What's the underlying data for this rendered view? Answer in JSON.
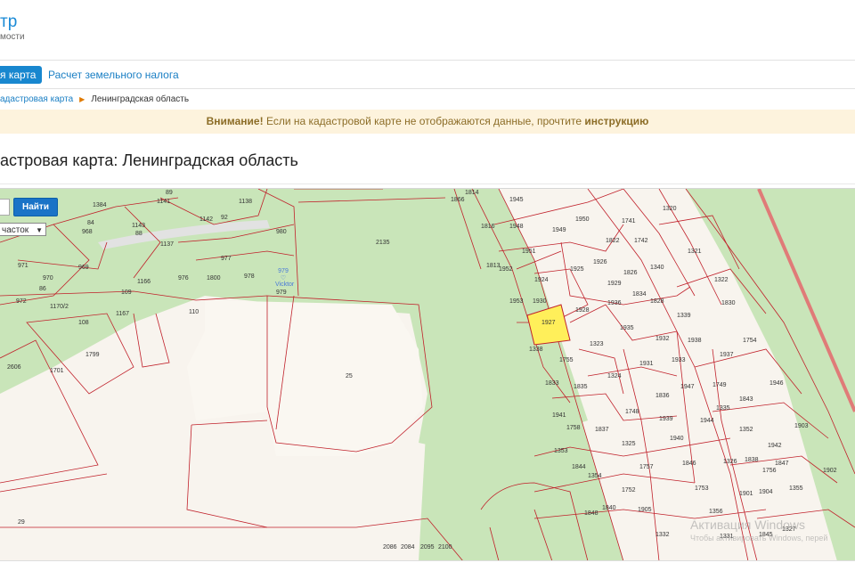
{
  "header": {
    "logo_title": "тр",
    "logo_subtitle": "мости"
  },
  "nav": {
    "tabs": [
      {
        "label": "я карта"
      },
      {
        "label": "Расчет земельного налога"
      }
    ]
  },
  "breadcrumbs": [
    "адастровая карта",
    "Ленинградская область"
  ],
  "notice": {
    "prefix": "Внимание!",
    "text": " Если на кадастровой карте не отображаются данные, прочтите ",
    "link": "инструкцию"
  },
  "page": {
    "title": "астровая карта: Ленинградская область"
  },
  "map_controls": {
    "search_value": "",
    "find_button": "Найти",
    "type_select": "часток",
    "marker_name": "Vicktor",
    "marker_number": "979"
  },
  "plots": [
    "89",
    "1141",
    "1384",
    "1138",
    "968",
    "84",
    "88",
    "1143",
    "1142",
    "92",
    "1137",
    "980",
    "971",
    "969",
    "977",
    "970",
    "86",
    "976",
    "978",
    "1166",
    "1800",
    "979",
    "972",
    "1170/2",
    "109",
    "1167",
    "110",
    "108",
    "1799",
    "1701",
    "2606",
    "25",
    "2135",
    "29",
    "2086",
    "2084",
    "2095",
    "2100",
    "1866",
    "1945",
    "1814",
    "1816",
    "1948",
    "1949",
    "1950",
    "1741",
    "1320",
    "1822",
    "1951",
    "1742",
    "1813",
    "1952",
    "1925",
    "1926",
    "1826",
    "1340",
    "1321",
    "1924",
    "1929",
    "1322",
    "1953",
    "1928",
    "1834",
    "1828",
    "1927",
    "1339",
    "1936",
    "1930",
    "1935",
    "1830",
    "1338",
    "1323",
    "1932",
    "1938",
    "1754",
    "1755",
    "1931",
    "1933",
    "1937",
    "1833",
    "1835",
    "1324",
    "1947",
    "1749",
    "1946",
    "1836",
    "1843",
    "1748",
    "1939",
    "1944",
    "1335",
    "1941",
    "1837",
    "1352",
    "1758",
    "1325",
    "1940",
    "1942",
    "1903",
    "1353",
    "1844",
    "1757",
    "1846",
    "1326",
    "1838",
    "1756",
    "1902",
    "1354",
    "1847",
    "1752",
    "1753",
    "1901",
    "1904",
    "1355",
    "1840",
    "1905",
    "1356",
    "1848",
    "1332",
    "1331",
    "1845",
    "1327"
  ],
  "watermark": {
    "line1": "Активация Windows",
    "line2": "Чтобы активировать Windows, перей"
  },
  "colors": {
    "accent": "#1887cf",
    "notice_bg": "#fdf3dd",
    "parcel_border": "#c0202a",
    "selected_parcel": "#ffef5a",
    "forest": "#c9e5b9"
  }
}
